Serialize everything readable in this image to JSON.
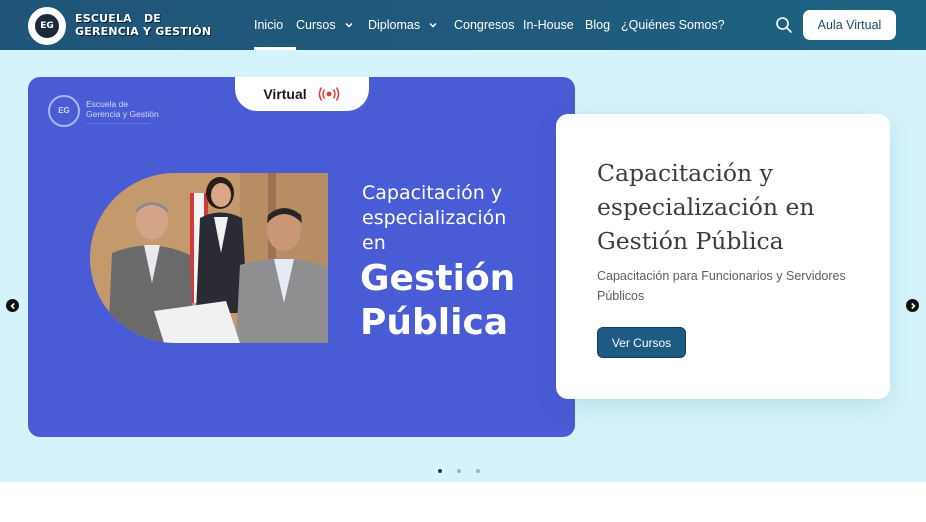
{
  "header": {
    "logo_line1": "ESCUELA   DE",
    "logo_line2": "GERENCIA Y GESTIÓN",
    "logo_seal": "EG",
    "nav": [
      {
        "label": "Inicio",
        "active": true
      },
      {
        "label": "Cursos",
        "dropdown": true
      },
      {
        "label": "Diplomas",
        "dropdown": true
      },
      {
        "label": "Congresos"
      },
      {
        "label": "In-House"
      },
      {
        "label": "Blog"
      },
      {
        "label": "¿Quiénes Somos?"
      }
    ],
    "search_icon": "search-icon",
    "aula_button": "Aula Virtual"
  },
  "slide": {
    "virtual_label": "Virtual",
    "live_icon": "broadcast-icon",
    "banner_logo_seal": "EG",
    "banner_logo_line1": "Escuela de",
    "banner_logo_line2": "Gerencia y Gestión",
    "banner_heading_small": "Capacitación y\nespecialización\nen",
    "banner_heading_big": "Gestión\nPública",
    "card_title": "Capacitación y especialización en Gestión Pública",
    "card_subtitle": "Capacitación para Funcionarios y Servidores Públicos",
    "card_button": "Ver Cursos"
  },
  "carousel": {
    "prev_icon": "chevron-left-icon",
    "next_icon": "chevron-right-icon",
    "slide_count": 3,
    "active_index": 0
  },
  "colors": {
    "navbar": "#205a7c",
    "hero_bg": "#d5f3fb",
    "banner_bg": "#4a5bd6",
    "button_bg": "#1e5b82",
    "live_red": "#e23b3b"
  }
}
